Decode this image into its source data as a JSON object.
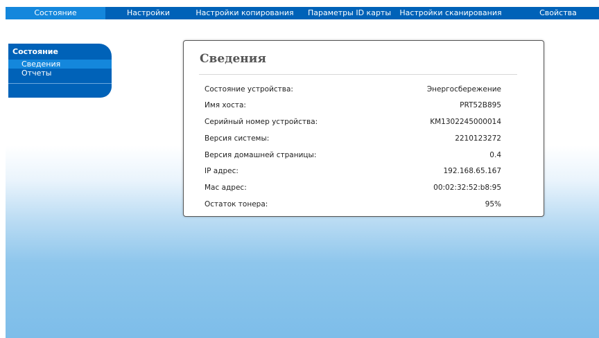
{
  "topnav": {
    "tabs": [
      {
        "label": "Состояние",
        "active": true
      },
      {
        "label": "Настройки",
        "active": false
      },
      {
        "label": "Настройки копирования",
        "active": false
      },
      {
        "label": "Параметры ID карты",
        "active": false
      },
      {
        "label": "Настройки сканирования",
        "active": false
      },
      {
        "label": "Свойства",
        "active": false
      }
    ]
  },
  "sidebar": {
    "heading": "Состояние",
    "items": [
      {
        "label": "Сведения",
        "active": true
      },
      {
        "label": "Отчеты",
        "active": false
      }
    ]
  },
  "panel": {
    "title": "Сведения",
    "rows": [
      {
        "label": "Состояние устройства:",
        "value": "Энергосбережение"
      },
      {
        "label": "Имя хоста:",
        "value": "PRT52B895"
      },
      {
        "label": "Серийный номер устройства:",
        "value": "KM1302245000014"
      },
      {
        "label": "Версия системы:",
        "value": "2210123272"
      },
      {
        "label": "Версия домашней страницы:",
        "value": "0.4"
      },
      {
        "label": "IP адрес:",
        "value": "192.168.65.167"
      },
      {
        "label": "Mac адрес:",
        "value": "00:02:32:52:b8:95"
      },
      {
        "label": "Остаток тонера:",
        "value": "95%"
      }
    ]
  },
  "colors": {
    "nav": "#0062b8",
    "nav_active": "#1487dc",
    "background_bottom": "#7dbde9"
  }
}
